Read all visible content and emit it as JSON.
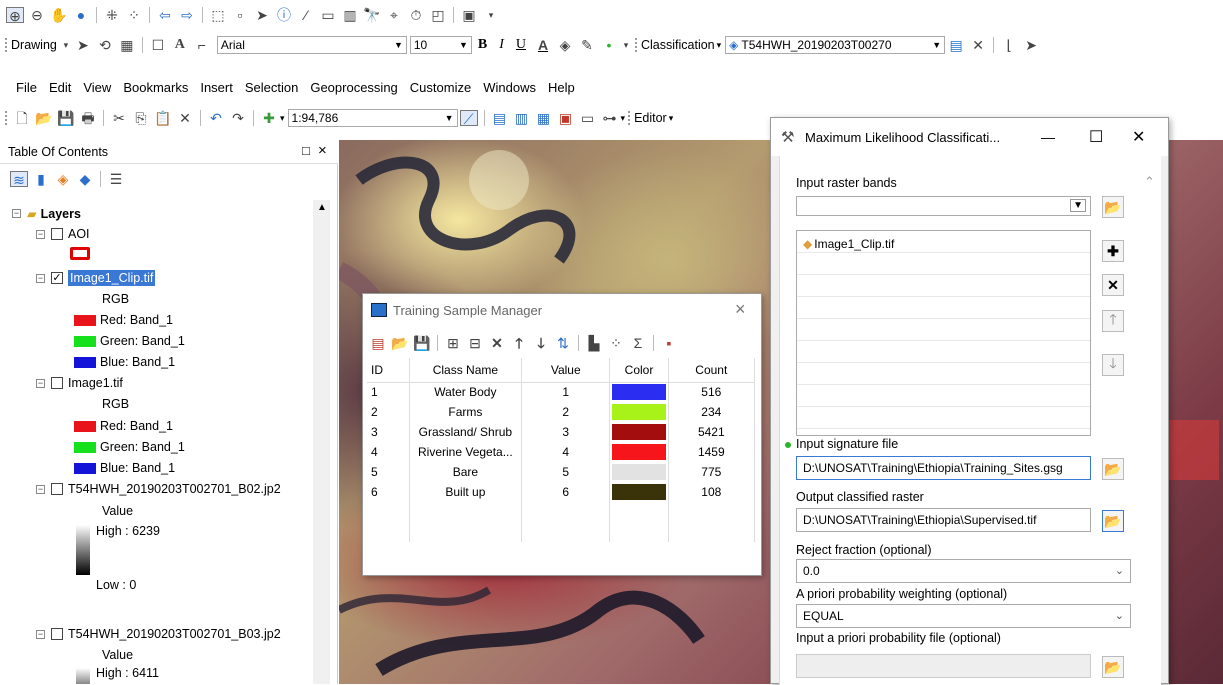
{
  "toolbar1": {
    "items": [
      "zoom-in",
      "zoom-out",
      "pan",
      "full-extent",
      "fixed-zoom-in",
      "fixed-zoom-out",
      "back",
      "forward",
      "select",
      "clear",
      "pointer",
      "identify",
      "hyperlink",
      "html-popup",
      "measure",
      "find",
      "goto-xy",
      "time-slider",
      "create-viewer",
      "catalog"
    ]
  },
  "drawing_bar": {
    "drawing_label": "Drawing",
    "font_name": "Arial",
    "font_size": "10",
    "bold": "B",
    "italic": "I",
    "underline": "U",
    "classification_label": "Classification",
    "classification_layer": "T54HWH_20190203T00270"
  },
  "menu": [
    "File",
    "Edit",
    "View",
    "Bookmarks",
    "Insert",
    "Selection",
    "Geoprocessing",
    "Customize",
    "Windows",
    "Help"
  ],
  "standard_bar": {
    "scale": "1:94,786",
    "editor_label": "Editor"
  },
  "toc": {
    "title": "Table Of Contents",
    "close": "×",
    "pin": "□",
    "layers_label": "Layers",
    "aoi": "AOI",
    "image1clip": "Image1_Clip.tif",
    "rgb1": "RGB",
    "red1": "Red:  Band_1",
    "green1": "Green: Band_1",
    "blue1": "Blue:  Band_1",
    "image1": "Image1.tif",
    "rgb2": "RGB",
    "red2": "Red:  Band_1",
    "green2": "Green: Band_1",
    "blue2": "Blue:  Band_1",
    "b02": "T54HWH_20190203T002701_B02.jp2",
    "value1": "Value",
    "high1": "High : 6239",
    "low1": "Low : 0",
    "b03": "T54HWH_20190203T002701_B03.jp2",
    "value2": "Value",
    "high2": "High : 6411",
    "colors": {
      "red": "#e8131b",
      "green": "#17e11c",
      "blue": "#1414d8",
      "aoi": "#e00000"
    }
  },
  "tsm": {
    "title": "Training Sample Manager",
    "close": "×",
    "headers": [
      "ID",
      "Class Name",
      "Value",
      "Color",
      "Count"
    ],
    "rows": [
      {
        "id": "1",
        "name": "Water Body",
        "value": "1",
        "color": "#2b2ef0",
        "count": "516"
      },
      {
        "id": "2",
        "name": "Farms",
        "value": "2",
        "color": "#a8f21a",
        "count": "234"
      },
      {
        "id": "3",
        "name": "Grassland/ Shrub",
        "value": "3",
        "color": "#a30d0d",
        "count": "5421"
      },
      {
        "id": "4",
        "name": "Riverine Vegeta...",
        "value": "4",
        "color": "#f5151b",
        "count": "1459"
      },
      {
        "id": "5",
        "name": "Bare",
        "value": "5",
        "color": "#e2e2e2",
        "count": "775"
      },
      {
        "id": "6",
        "name": "Built up",
        "value": "6",
        "color": "#3a330a",
        "count": "108"
      }
    ]
  },
  "mlc": {
    "title": "Maximum Likelihood Classificati...",
    "minimize": "—",
    "maximize": "☐",
    "close": "✕",
    "input_bands_label": "Input raster bands",
    "band_item": "Image1_Clip.tif",
    "signature_label": "Input signature file",
    "signature_value": "D:\\UNOSAT\\Training\\Ethiopia\\Training_Sites.gsg",
    "output_label": "Output classified raster",
    "output_value": "D:\\UNOSAT\\Training\\Ethiopia\\Supervised.tif",
    "reject_label": "Reject fraction (optional)",
    "reject_value": "0.0",
    "apriori_label": "A priori probability weighting (optional)",
    "apriori_value": "EQUAL",
    "apriori_file_label": "Input a priori probability file (optional)"
  }
}
